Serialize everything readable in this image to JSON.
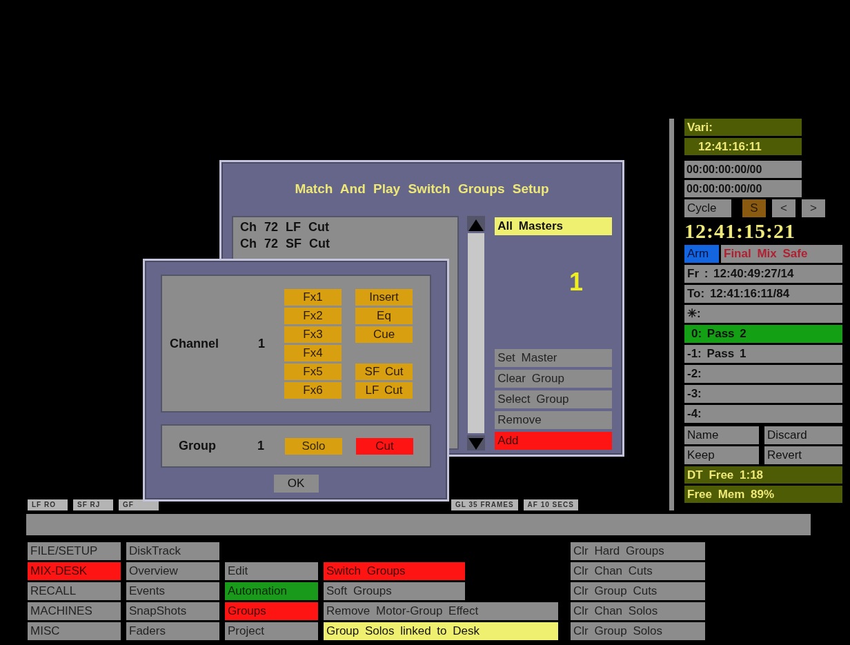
{
  "main_dialog": {
    "title": "Match And Play Switch Groups Setup",
    "list_items": [
      "Ch 72 LF Cut",
      "Ch 72 SF Cut"
    ],
    "master_selector": "All Masters",
    "group_number": "1",
    "actions": [
      {
        "label": "Set Master",
        "color": "#8c8c8c"
      },
      {
        "label": "Clear Group",
        "color": "#8c8c8c"
      },
      {
        "label": "Select Group",
        "color": "#8c8c8c"
      },
      {
        "label": "Remove",
        "color": "#8c8c8c"
      },
      {
        "label": "Add",
        "color": "#ff1414"
      }
    ]
  },
  "channel_dialog": {
    "channel_label": "Channel",
    "channel_number": "1",
    "button_rows": [
      {
        "left": "Fx1",
        "right": "Insert"
      },
      {
        "left": "Fx2",
        "right": "Eq"
      },
      {
        "left": "Fx3",
        "right": "Cue"
      },
      {
        "left": "Fx4"
      },
      {
        "left": "Fx5",
        "right": "SF Cut"
      },
      {
        "left": "Fx6",
        "right": "LF Cut"
      }
    ],
    "group_label": "Group",
    "group_number": "1",
    "group_buttons": [
      {
        "label": "Solo",
        "color": "#d8a010"
      },
      {
        "label": "Cut",
        "color": "#ff1414"
      }
    ],
    "ok": "OK"
  },
  "left_chips": [
    "LF RO",
    "SF RJ",
    "GF"
  ],
  "right_chips": [
    "GL 35 FRAMES",
    "AF 10 SECS"
  ],
  "transport": {
    "vari_label": "Vari:",
    "vari_time": "12:41:16:11",
    "timecodes": [
      "00:00:00:00/00",
      "00:00:00:00/00"
    ],
    "cycle": "Cycle",
    "cycle_buttons": [
      {
        "label": "S",
        "color": "#8a5a10"
      },
      {
        "label": "<",
        "color": "#8c8c8c"
      },
      {
        "label": ">",
        "color": "#8c8c8c"
      }
    ],
    "clock": "12:41:15:21",
    "arm": "Arm",
    "safe_label": "Final Mix Safe",
    "from": "Fr : 12:40:49:27/14",
    "to": "To: 12:41:16:11/84",
    "passes": [
      {
        "label": "✳:",
        "selected": false
      },
      {
        "label": "0: Pass 2",
        "selected": true
      },
      {
        "label": "-1: Pass 1",
        "selected": false
      },
      {
        "label": "-2:",
        "selected": false
      },
      {
        "label": "-3:",
        "selected": false
      },
      {
        "label": "-4:",
        "selected": false
      }
    ],
    "pass_actions": [
      "Name",
      "Discard",
      "Keep",
      "Revert"
    ],
    "dt_free": "DT Free 1:18",
    "free_mem": "Free Mem 89%"
  },
  "menu": {
    "columns": [
      [
        {
          "label": "FILE/SETUP",
          "color": "#8c8c8c"
        },
        {
          "label": "MIX-DESK",
          "color": "#ff1414"
        },
        {
          "label": "RECALL",
          "color": "#8c8c8c"
        },
        {
          "label": "MACHINES",
          "color": "#8c8c8c"
        },
        {
          "label": "MISC",
          "color": "#8c8c8c"
        }
      ],
      [
        {
          "label": "DiskTrack",
          "color": "#8c8c8c"
        },
        {
          "label": "Overview",
          "color": "#8c8c8c"
        },
        {
          "label": "Events",
          "color": "#8c8c8c"
        },
        {
          "label": "SnapShots",
          "color": "#8c8c8c"
        },
        {
          "label": "Faders",
          "color": "#8c8c8c"
        }
      ],
      [
        null,
        {
          "label": "Edit",
          "color": "#8c8c8c"
        },
        {
          "label": "Automation",
          "color": "#1a9a1a"
        },
        {
          "label": "Groups",
          "color": "#ff1414"
        },
        {
          "label": "Project",
          "color": "#8c8c8c"
        }
      ],
      [
        null,
        {
          "label": "Switch Groups",
          "color": "#ff1414"
        },
        {
          "label": "Soft Groups",
          "color": "#8c8c8c"
        },
        {
          "label": "Remove Motor-Group Effect",
          "color": "#8c8c8c"
        },
        {
          "label": "Group Solos linked to Desk",
          "color": "#f0f070"
        }
      ],
      [
        {
          "label": "Clr Hard Groups",
          "color": "#8c8c8c"
        },
        {
          "label": "Clr Chan Cuts",
          "color": "#8c8c8c"
        },
        {
          "label": "Clr Group Cuts",
          "color": "#8c8c8c"
        },
        {
          "label": "Clr Chan Solos",
          "color": "#8c8c8c"
        },
        {
          "label": "Clr Group Solos",
          "color": "#8c8c8c"
        }
      ]
    ]
  }
}
